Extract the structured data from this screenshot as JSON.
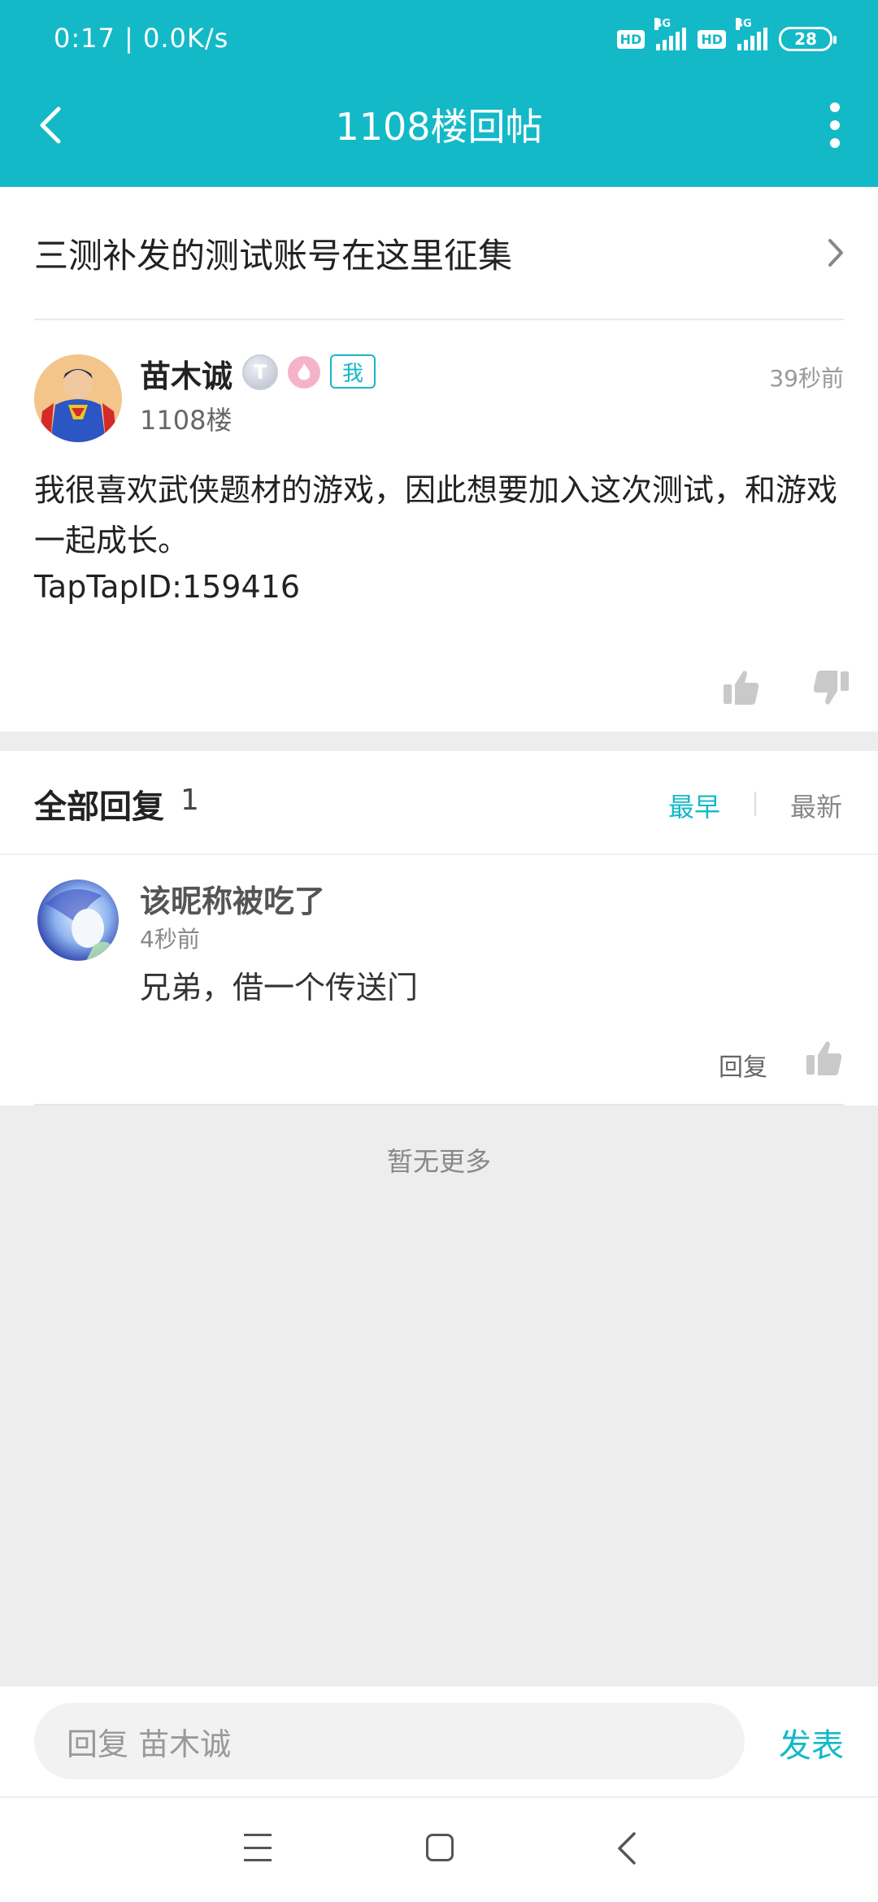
{
  "status_bar": {
    "time": "0:17 | 0.0K/s",
    "hd1": "HD",
    "net1": "4G",
    "hd2": "HD",
    "net2": "4G",
    "battery": "28"
  },
  "navbar": {
    "title": "1108楼回帖"
  },
  "thread": {
    "title": "三测补发的测试账号在这里征集"
  },
  "post": {
    "author": "苗木诚",
    "level_badge": "T",
    "me_tag": "我",
    "time": "39秒前",
    "floor": "1108楼",
    "body": "我很喜欢武侠题材的游戏，因此想要加入这次测试，和游戏一起成长。",
    "taptap_id": "TapTapID:159416"
  },
  "replies": {
    "title": "全部回复",
    "count": "1",
    "sort_earliest": "最早",
    "sort_newest": "最新",
    "items": [
      {
        "name": "该昵称被吃了",
        "time": "4秒前",
        "text": "兄弟，借一个传送门",
        "reply_label": "回复"
      }
    ],
    "no_more": "暂无更多"
  },
  "input_bar": {
    "placeholder": "回复 苗木诚",
    "publish_label": "发表"
  },
  "colors": {
    "accent": "#14b9c8",
    "background": "#ededed"
  }
}
